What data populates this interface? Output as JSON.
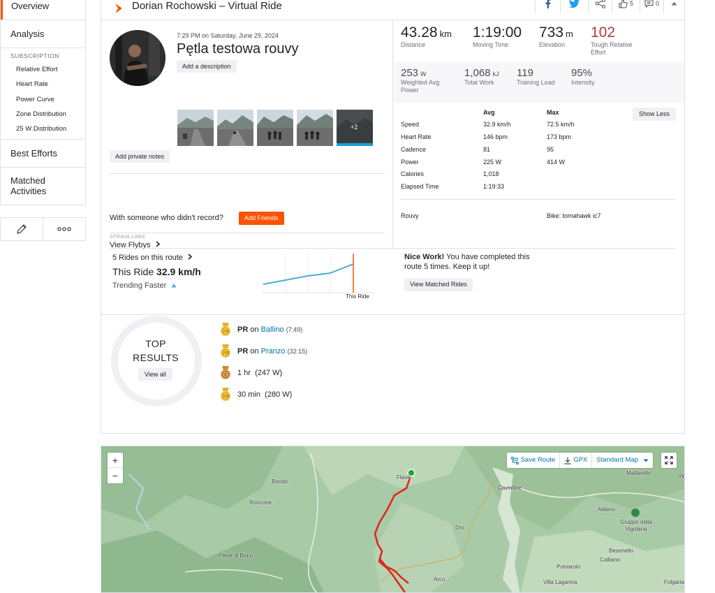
{
  "sidebar": {
    "overview": "Overview",
    "analysis": "Analysis",
    "subscription_title": "SUBSCRIPTION",
    "sub_items": [
      "Relative Effort",
      "Heart Rate",
      "Power Curve",
      "Zone Distribution",
      "25 W Distribution"
    ],
    "best_efforts": "Best Efforts",
    "matched_activities": "Matched Activities"
  },
  "header": {
    "title": "Dorian Rochowski – Virtual Ride",
    "kudos_count": "5",
    "comments_count": "0"
  },
  "activity": {
    "date": "7:29 PM on Saturday, June 29, 2024",
    "name": "Pętla testowa rouvy",
    "add_description": "Add a description",
    "extra_photos": "+2",
    "add_private_notes": "Add private notes",
    "someone_text": "With someone who didn't record?",
    "add_friends": "Add Friends",
    "strava_labs": "STRAVA LABS",
    "view_flybys": "View Flybys"
  },
  "stats": {
    "distance": {
      "value": "43.28",
      "unit": "km",
      "label": "Distance"
    },
    "moving_time": {
      "value": "1:19:00",
      "label": "Moving Time"
    },
    "elevation": {
      "value": "733",
      "unit": "m",
      "label": "Elevation"
    },
    "relative_effort": {
      "value": "102",
      "label": "Tough Relative Effort"
    },
    "power": {
      "value": "253",
      "unit": "W",
      "label": "Weighted Avg Power"
    },
    "work": {
      "value": "1,068",
      "unit": "kJ",
      "label": "Total Work"
    },
    "training_load": {
      "value": "119",
      "label": "Training Load"
    },
    "intensity": {
      "value": "95%",
      "label": "Intensity"
    }
  },
  "more_stats": {
    "avg_header": "Avg",
    "max_header": "Max",
    "show_less": "Show Less",
    "rows": [
      {
        "label": "Speed",
        "avg": "32.9 km/h",
        "max": "72.5 km/h"
      },
      {
        "label": "Heart Rate",
        "avg": "146 bpm",
        "max": "173 bpm"
      },
      {
        "label": "Cadence",
        "avg": "81",
        "max": "95"
      },
      {
        "label": "Power",
        "avg": "225 W",
        "max": "414 W"
      },
      {
        "label": "Calories",
        "avg": "1,018",
        "max": ""
      },
      {
        "label": "Elapsed Time",
        "avg": "1:19:33",
        "max": ""
      }
    ],
    "device": "Rouvy",
    "bike": "Bike: tomahawk ic7"
  },
  "route": {
    "rides_count": "5 Rides on this route",
    "this_ride_prefix": "This Ride",
    "this_ride_speed": "32.9 km/h",
    "trending": "Trending Faster",
    "chart_marker_label": "This Ride",
    "nice_work_bold": "Nice Work!",
    "nice_work_text": "You have completed this route 5 times. Keep it up!",
    "view_matched": "View Matched Rides"
  },
  "top_results": {
    "title_line1": "TOP",
    "title_line2": "RESULTS",
    "view_all": "View all",
    "items": [
      {
        "prefix": "PR",
        "on": "on",
        "segment": "Ballino",
        "detail": "(7:49)"
      },
      {
        "prefix": "PR",
        "on": "on",
        "segment": "Pranzo",
        "detail": "(32:15)"
      },
      {
        "text": "1 hr",
        "detail": "(247 W)"
      },
      {
        "text": "30 min",
        "detail": "(280 W)"
      }
    ]
  },
  "map": {
    "zoom_in": "+",
    "zoom_out": "−",
    "save_route": "Save Route",
    "gpx": "GPX",
    "map_type": "Standard Map",
    "places": [
      "Bondo",
      "Roncone",
      "Pieve di Bono",
      "Flavè",
      "Cavedine",
      "Dro",
      "Arco",
      "Mattarello",
      "Aldeno",
      "Gruppo della Vigolana",
      "Besenello",
      "Calliano",
      "Pomarolo",
      "Villa Lagarina",
      "Folgaria",
      "Vig"
    ]
  },
  "colors": {
    "accent": "#fc5200",
    "link": "#0073a8",
    "relative_effort": "#b33a3a",
    "trend_line": "#4aaed4",
    "route": "#e0241b"
  }
}
